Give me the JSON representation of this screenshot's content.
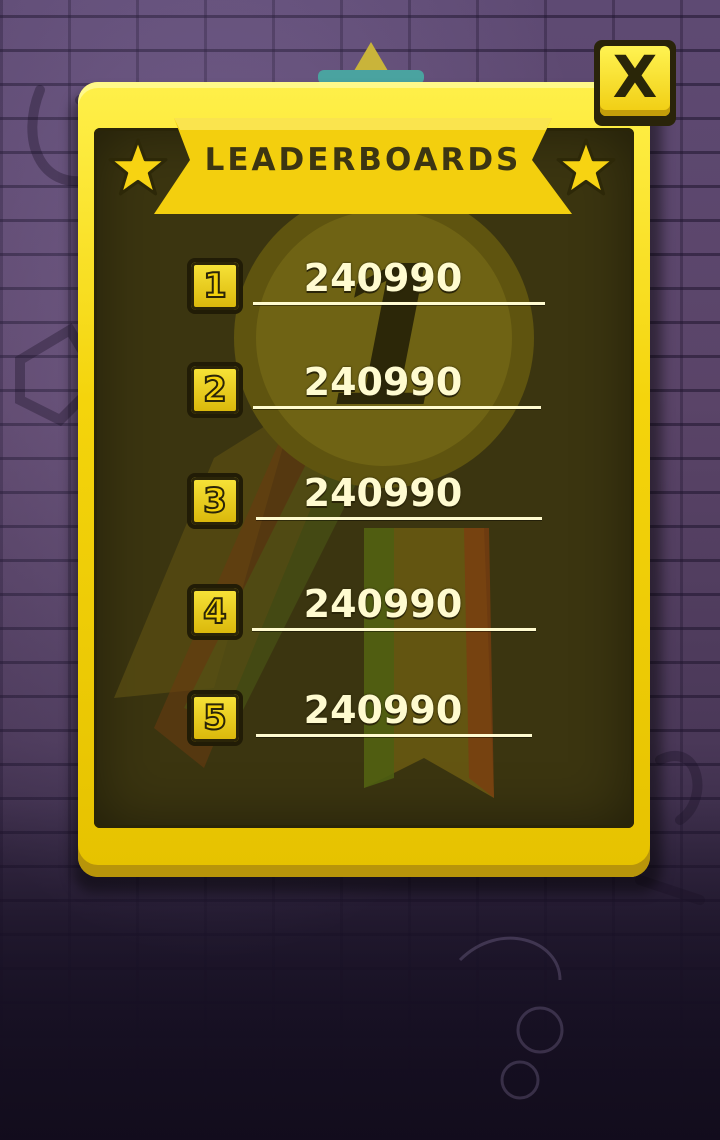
{
  "screen": {
    "title": "LEADERBOARDS",
    "close_label": "X"
  },
  "leaderboard": {
    "entries": [
      {
        "rank": "1",
        "score": "240990"
      },
      {
        "rank": "2",
        "score": "240990"
      },
      {
        "rank": "3",
        "score": "240990"
      },
      {
        "rank": "4",
        "score": "240990"
      },
      {
        "rank": "5",
        "score": "240990"
      }
    ]
  },
  "medal": {
    "label": "1"
  },
  "colors": {
    "board_yellow": "#f4d40c",
    "board_dark": "#3b3510",
    "score_text": "#fffbd0"
  },
  "icons": [
    "close-icon",
    "star-icon",
    "medal-icon",
    "hook-icon"
  ]
}
